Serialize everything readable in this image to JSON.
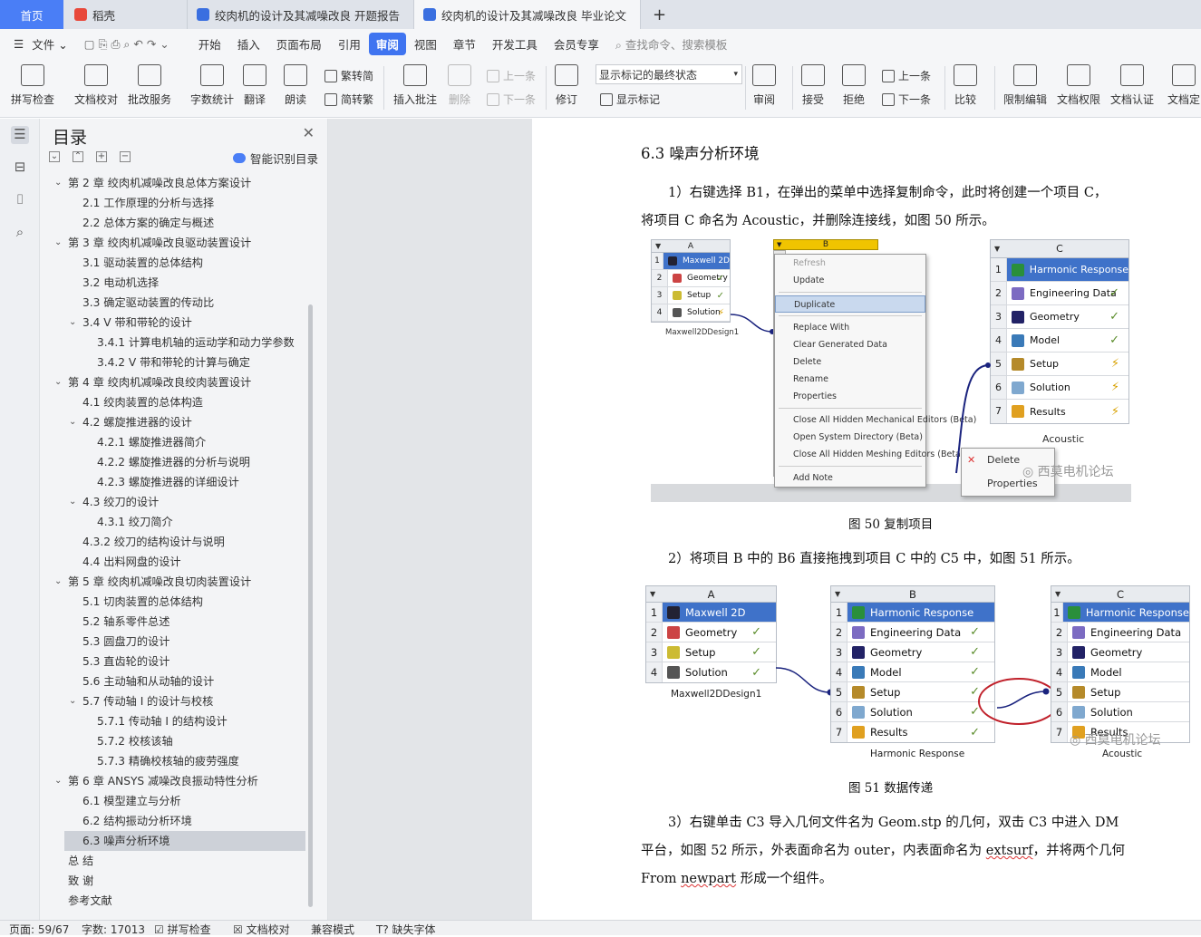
{
  "tabs": {
    "home": "首页",
    "t1": "稻壳",
    "t2": "绞肉机的设计及其减噪改良 开题报告",
    "t3": "绞肉机的设计及其减噪改良 毕业论文",
    "add": "+"
  },
  "menu": {
    "file": "文件",
    "items": [
      "开始",
      "插入",
      "页面布局",
      "引用",
      "审阅",
      "视图",
      "章节",
      "开发工具",
      "会员专享"
    ],
    "search": "查找命令、搜索模板"
  },
  "toolbar": {
    "spell": "拼写检查",
    "doccheck": "文档校对",
    "comment_service": "批改服务",
    "wordcount": "字数统计",
    "translate": "翻译",
    "read": "朗读",
    "trad": "繁转简",
    "simp": "简转繁",
    "insert_comment": "插入批注",
    "delete": "删除",
    "prev": "上一条",
    "next": "下一条",
    "revise": "修订",
    "show_state": "显示标记的最终状态",
    "show_marks": "显示标记",
    "review": "审阅",
    "accept": "接受",
    "reject": "拒绝",
    "prev2": "上一条",
    "next2": "下一条",
    "compare": "比较",
    "restrict": "限制编辑",
    "perm": "文档权限",
    "cert": "文档认证",
    "final": "文档定"
  },
  "toc": {
    "title": "目录",
    "smart": "智能识别目录",
    "items": [
      "第 2 章  绞肉机减噪改良总体方案设计",
      "2.1  工作原理的分析与选择",
      "2.2  总体方案的确定与概述",
      "第 3 章  绞肉机减噪改良驱动装置设计",
      "3.1 驱动装置的总体结构",
      "3.2  电动机选择",
      "3.3 确定驱动装置的传动比",
      "3.4 V 带和带轮的设计",
      "3.4.1  计算电机轴的运动学和动力学参数",
      "3.4.2 V  带和带轮的计算与确定",
      "第 4 章  绞肉机减噪改良绞肉装置设计",
      "4.1 绞肉装置的总体构造",
      "4.2  螺旋推进器的设计",
      "4.2.1 螺旋推进器简介",
      "4.2.2 螺旋推进器的分析与说明",
      "4.2.3 螺旋推进器的详细设计",
      "4.3 绞刀的设计",
      "4.3.1 绞刀简介",
      "4.3.2 绞刀的结构设计与说明",
      "4.4 出料网盘的设计",
      "第 5 章  绞肉机减噪改良切肉装置设计",
      "5.1 切肉装置的总体结构",
      "5.2 轴系零件总述",
      "5.3 圆盘刀的设计",
      "5.3 直齿轮的设计",
      "5.6 主动轴和从动轴的设计",
      "5.7 传动轴 I 的设计与校核",
      "5.7.1 传动轴 I 的结构设计",
      "5.7.2 校核该轴",
      "5.7.3  精确校核轴的疲劳强度",
      "第 6 章  ANSYS 减噪改良振动特性分析",
      "6.1 模型建立与分析",
      "6.2 结构振动分析环境",
      "6.3 噪声分析环境",
      "总  结",
      "致   谢",
      "参考文献"
    ]
  },
  "doc": {
    "heading": "6.3 噪声分析环境",
    "p1a": "1）右键选择 B1，在弹出的菜单中选择复制命令，此时将创建一个项目 C，",
    "p1b": "将项目 C 命名为 Acoustic，并删除连接线，如图 50 所示。",
    "cap50": "图 50  复制项目",
    "p2": "2）将项目 B 中的 B6 直接拖拽到项目 C 中的 C5 中，如图 51 所示。",
    "cap51": "图 51  数据传递",
    "p3a": "3）右键单击 C3 导入几何文件名为 Geom.stp 的几何，双击 C3 中进入 DM",
    "p3b_1": "平台，如图 52 所示，外表面命名为 outer，内表面命名为 ",
    "p3b_2": "extsurf",
    "p3b_3": "，并将两个几何",
    "p3c_1": "From ",
    "p3c_2": "newpart",
    "p3c_3": " 形成一个组件。"
  },
  "fig50": {
    "A": {
      "hd": "A",
      "rows": [
        "Maxwell 2D",
        "Geometry",
        "Setup",
        "Solution"
      ],
      "foot": "Maxwell2DDesign1"
    },
    "B": {
      "hd": "B"
    },
    "menu": [
      "Refresh",
      "Update",
      "Duplicate",
      "Replace With",
      "Clear Generated Data",
      "Delete",
      "Rename",
      "Properties",
      "Close All Hidden Mechanical Editors (Beta)",
      "Open System Directory (Beta)",
      "Close All Hidden Meshing Editors (Beta)",
      "Add Note"
    ],
    "C": {
      "hd": "C",
      "rows": [
        "Harmonic Response",
        "Engineering Data",
        "Geometry",
        "Model",
        "Setup",
        "Solution",
        "Results"
      ],
      "foot": "Acoustic"
    },
    "menu2": [
      "Delete",
      "Properties"
    ],
    "watermark": "西莫电机论坛"
  },
  "fig51": {
    "A": {
      "hd": "A",
      "rows": [
        "Maxwell 2D",
        "Geometry",
        "Setup",
        "Solution"
      ],
      "foot": "Maxwell2DDesign1"
    },
    "B": {
      "hd": "B",
      "rows": [
        "Harmonic Response",
        "Engineering Data",
        "Geometry",
        "Model",
        "Setup",
        "Solution",
        "Results"
      ],
      "foot": "Harmonic Response"
    },
    "C": {
      "hd": "C",
      "rows": [
        "Harmonic Response",
        "Engineering Data",
        "Geometry",
        "Model",
        "Setup",
        "Solution",
        "Results"
      ],
      "foot": "Acoustic"
    },
    "watermark": "西莫电机论坛"
  },
  "status": {
    "page": "页面: 59/67",
    "words": "字数: 17013",
    "spell": "拼写检查",
    "check": "文档校对",
    "compat": "兼容模式",
    "font": "缺失字体"
  },
  "colors": {
    "accent": "#3f74f0",
    "highlight": "#3f72c9",
    "check": "#5a8c2a"
  }
}
